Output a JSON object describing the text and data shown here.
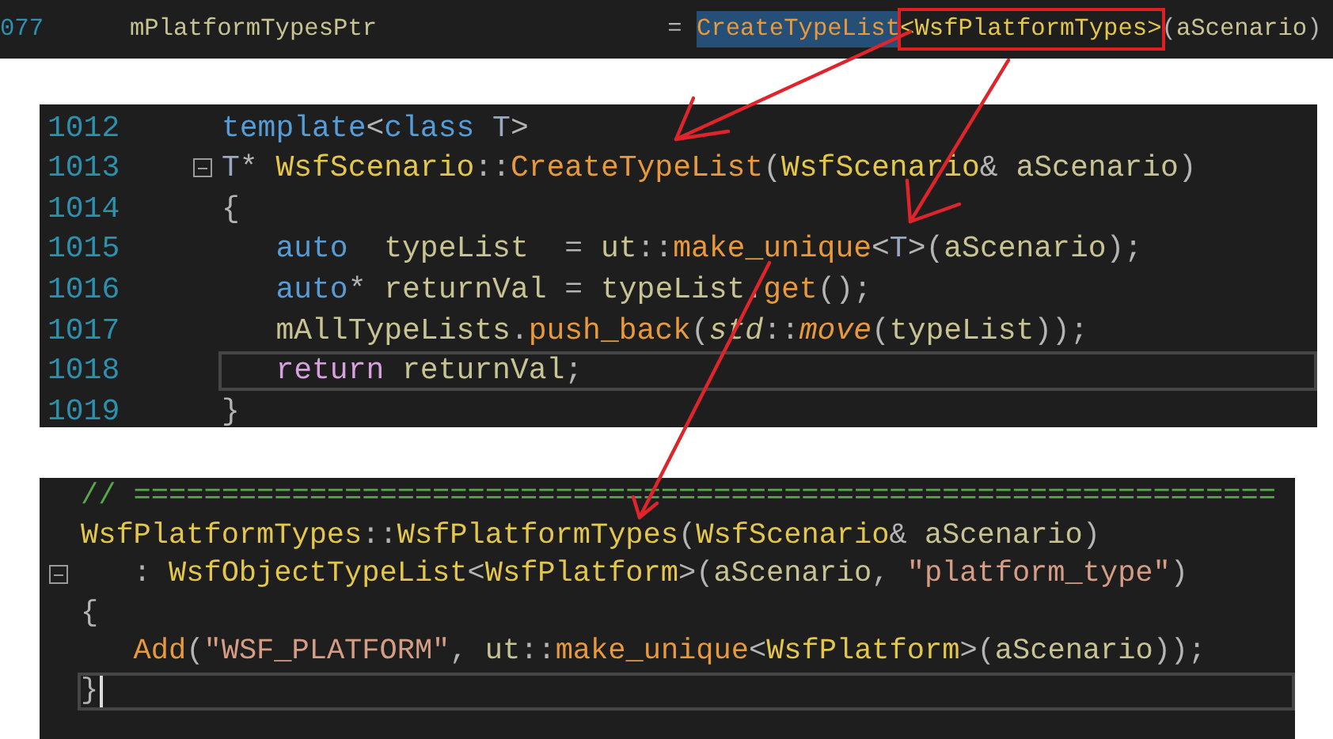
{
  "top_strip": {
    "lines": [
      {
        "number": "077",
        "tokens": [
          {
            "kind": "variable",
            "text": "mPlatformTypesPtr                    "
          },
          {
            "kind": "punct",
            "text": "= "
          },
          {
            "kind": "function",
            "text": "CreateTypeList",
            "highlighted": true
          },
          {
            "kind": "type",
            "text": "<WsfPlatformTypes>",
            "boxed": true
          },
          {
            "kind": "punct",
            "text": "("
          },
          {
            "kind": "variable",
            "text": "aScenario"
          },
          {
            "kind": "punct",
            "text": ")"
          }
        ]
      }
    ]
  },
  "template_panel": {
    "lines": [
      {
        "number": "1012",
        "tokens": [
          {
            "kind": "keyword",
            "text": "template"
          },
          {
            "kind": "punct",
            "text": "<"
          },
          {
            "kind": "keyword",
            "text": "class "
          },
          {
            "kind": "param",
            "text": "T"
          },
          {
            "kind": "punct",
            "text": ">"
          }
        ]
      },
      {
        "number": "1013",
        "foldable": true,
        "tokens": [
          {
            "kind": "param",
            "text": "T"
          },
          {
            "kind": "punct",
            "text": "* "
          },
          {
            "kind": "type",
            "text": "WsfScenario"
          },
          {
            "kind": "punct",
            "text": "::"
          },
          {
            "kind": "function",
            "text": "CreateTypeList"
          },
          {
            "kind": "punct",
            "text": "("
          },
          {
            "kind": "type",
            "text": "WsfScenario"
          },
          {
            "kind": "punct",
            "text": "& "
          },
          {
            "kind": "variable",
            "text": "aScenario"
          },
          {
            "kind": "punct",
            "text": ")"
          }
        ]
      },
      {
        "number": "1014",
        "tokens": [
          {
            "kind": "punct",
            "text": "{"
          }
        ]
      },
      {
        "number": "1015",
        "tokens": [
          {
            "kind": "keyword",
            "text": "   auto  "
          },
          {
            "kind": "variable",
            "text": "typeList  "
          },
          {
            "kind": "punct",
            "text": "= "
          },
          {
            "kind": "variable",
            "text": "ut"
          },
          {
            "kind": "punct",
            "text": "::"
          },
          {
            "kind": "function",
            "text": "make_unique"
          },
          {
            "kind": "punct",
            "text": "<"
          },
          {
            "kind": "param",
            "text": "T"
          },
          {
            "kind": "punct",
            "text": ">("
          },
          {
            "kind": "variable",
            "text": "aScenario"
          },
          {
            "kind": "punct",
            "text": ");"
          }
        ]
      },
      {
        "number": "1016",
        "tokens": [
          {
            "kind": "keyword",
            "text": "   auto"
          },
          {
            "kind": "punct",
            "text": "* "
          },
          {
            "kind": "variable",
            "text": "returnVal "
          },
          {
            "kind": "punct",
            "text": "= "
          },
          {
            "kind": "variable",
            "text": "typeList"
          },
          {
            "kind": "punct",
            "text": "."
          },
          {
            "kind": "function",
            "text": "get"
          },
          {
            "kind": "punct",
            "text": "();"
          }
        ]
      },
      {
        "number": "1017",
        "tokens": [
          {
            "kind": "variable",
            "text": "   mAllTypeLists"
          },
          {
            "kind": "punct",
            "text": "."
          },
          {
            "kind": "function",
            "text": "push_back"
          },
          {
            "kind": "punct",
            "text": "("
          },
          {
            "kind": "namespace-italic",
            "text": "std"
          },
          {
            "kind": "punct",
            "text": "::"
          },
          {
            "kind": "function-italic",
            "text": "move"
          },
          {
            "kind": "punct",
            "text": "("
          },
          {
            "kind": "variable",
            "text": "typeList"
          },
          {
            "kind": "punct",
            "text": "));"
          }
        ]
      },
      {
        "number": "1018",
        "current": true,
        "tokens": [
          {
            "kind": "control",
            "text": "   return "
          },
          {
            "kind": "variable",
            "text": "returnVal"
          },
          {
            "kind": "punct",
            "text": ";"
          }
        ]
      },
      {
        "number": "1019",
        "tokens": [
          {
            "kind": "punct",
            "text": "}"
          }
        ]
      }
    ]
  },
  "constructor_panel": {
    "lines": [
      {
        "tokens": [
          {
            "kind": "comment",
            "text": "// ================================================================="
          }
        ]
      },
      {
        "tokens": [
          {
            "kind": "type",
            "text": "WsfPlatformTypes"
          },
          {
            "kind": "punct",
            "text": "::"
          },
          {
            "kind": "type",
            "text": "WsfPlatformTypes"
          },
          {
            "kind": "punct",
            "text": "("
          },
          {
            "kind": "type",
            "text": "WsfScenario"
          },
          {
            "kind": "punct",
            "text": "& "
          },
          {
            "kind": "variable",
            "text": "aScenario"
          },
          {
            "kind": "punct",
            "text": ")"
          }
        ]
      },
      {
        "foldable": true,
        "tokens": [
          {
            "kind": "punct",
            "text": "   : "
          },
          {
            "kind": "type",
            "text": "WsfObjectTypeList"
          },
          {
            "kind": "punct",
            "text": "<"
          },
          {
            "kind": "type",
            "text": "WsfPlatform"
          },
          {
            "kind": "punct",
            "text": ">("
          },
          {
            "kind": "variable",
            "text": "aScenario"
          },
          {
            "kind": "punct",
            "text": ", "
          },
          {
            "kind": "string",
            "text": "\"platform_type\""
          },
          {
            "kind": "punct",
            "text": ")"
          }
        ]
      },
      {
        "tokens": [
          {
            "kind": "punct",
            "text": "{"
          }
        ]
      },
      {
        "tokens": [
          {
            "kind": "function",
            "text": "   Add"
          },
          {
            "kind": "punct",
            "text": "("
          },
          {
            "kind": "string",
            "text": "\"WSF_PLATFORM\""
          },
          {
            "kind": "punct",
            "text": ", "
          },
          {
            "kind": "variable",
            "text": "ut"
          },
          {
            "kind": "punct",
            "text": "::"
          },
          {
            "kind": "function",
            "text": "make_unique"
          },
          {
            "kind": "punct",
            "text": "<"
          },
          {
            "kind": "type",
            "text": "WsfPlatform"
          },
          {
            "kind": "punct",
            "text": ">("
          },
          {
            "kind": "variable",
            "text": "aScenario"
          },
          {
            "kind": "punct",
            "text": "));"
          }
        ]
      },
      {
        "current": true,
        "cursor": true,
        "tokens": [
          {
            "kind": "punct",
            "text": "}"
          }
        ]
      }
    ]
  }
}
